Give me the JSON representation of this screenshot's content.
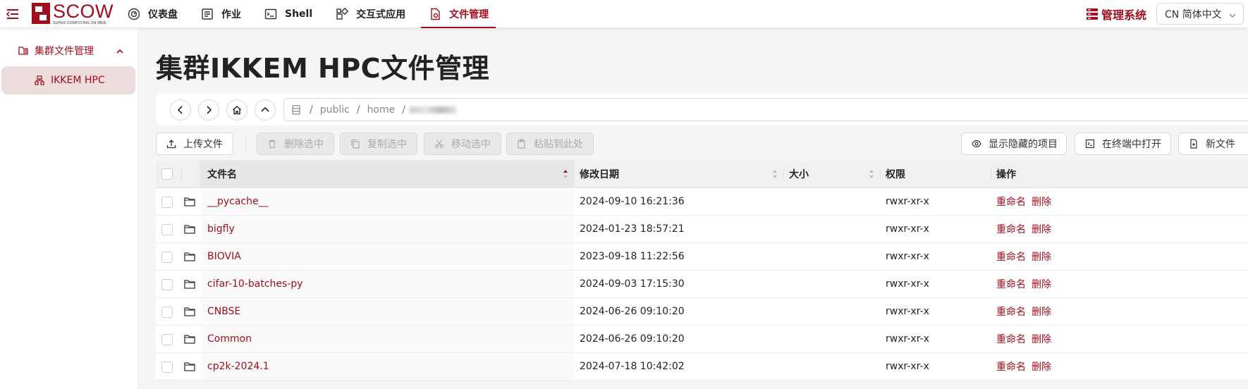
{
  "header": {
    "logo_title": "SCOW",
    "logo_sub": "SUPER COMPUTING ON WEB",
    "nav": [
      {
        "label": "仪表盘",
        "icon": "dashboard-icon"
      },
      {
        "label": "作业",
        "icon": "job-icon"
      },
      {
        "label": "Shell",
        "icon": "terminal-icon"
      },
      {
        "label": "交互式应用",
        "icon": "apps-icon"
      },
      {
        "label": "文件管理",
        "icon": "file-icon",
        "active": true
      }
    ],
    "mgmt_label": "管理系统",
    "language": "CN 简体中文"
  },
  "sidebar": {
    "group_label": "集群文件管理",
    "item_label": "IKKEM HPC"
  },
  "main": {
    "title": "集群IKKEM HPC文件管理",
    "path": {
      "root_sep": "/",
      "segments": [
        "public",
        "home"
      ]
    },
    "toolbar": {
      "upload": "上传文件",
      "delete_selected": "删除选中",
      "copy_selected": "复制选中",
      "move_selected": "移动选中",
      "paste_here": "粘贴到此处",
      "show_hidden": "显示隐藏的项目",
      "open_in_terminal": "在终端中打开",
      "new_file": "新文件"
    },
    "columns": {
      "name": "文件名",
      "modified": "修改日期",
      "size": "大小",
      "permissions": "权限",
      "actions": "操作"
    },
    "rows": [
      {
        "name": "__pycache__",
        "modified": "2024-09-10 16:21:36",
        "size": "",
        "perm": "rwxr-xr-x",
        "rename": "重命名",
        "delete": "删除"
      },
      {
        "name": "bigfly",
        "modified": "2024-01-23 18:57:21",
        "size": "",
        "perm": "rwxr-xr-x",
        "rename": "重命名",
        "delete": "删除"
      },
      {
        "name": "BIOVIA",
        "modified": "2023-09-18 11:22:56",
        "size": "",
        "perm": "rwxr-xr-x",
        "rename": "重命名",
        "delete": "删除"
      },
      {
        "name": "cifar-10-batches-py",
        "modified": "2024-09-03 17:15:30",
        "size": "",
        "perm": "rwxr-xr-x",
        "rename": "重命名",
        "delete": "删除"
      },
      {
        "name": "CNBSE",
        "modified": "2024-06-26 09:10:20",
        "size": "",
        "perm": "rwxr-xr-x",
        "rename": "重命名",
        "delete": "删除"
      },
      {
        "name": "Common",
        "modified": "2024-06-26 09:10:20",
        "size": "",
        "perm": "rwxr-xr-x",
        "rename": "重命名",
        "delete": "删除"
      },
      {
        "name": "cp2k-2024.1",
        "modified": "2024-07-18 10:42:02",
        "size": "",
        "perm": "rwxr-xr-x",
        "rename": "重命名",
        "delete": "删除"
      }
    ]
  },
  "colors": {
    "accent": "#a10d1d",
    "active_bg": "#ecdcdc"
  }
}
